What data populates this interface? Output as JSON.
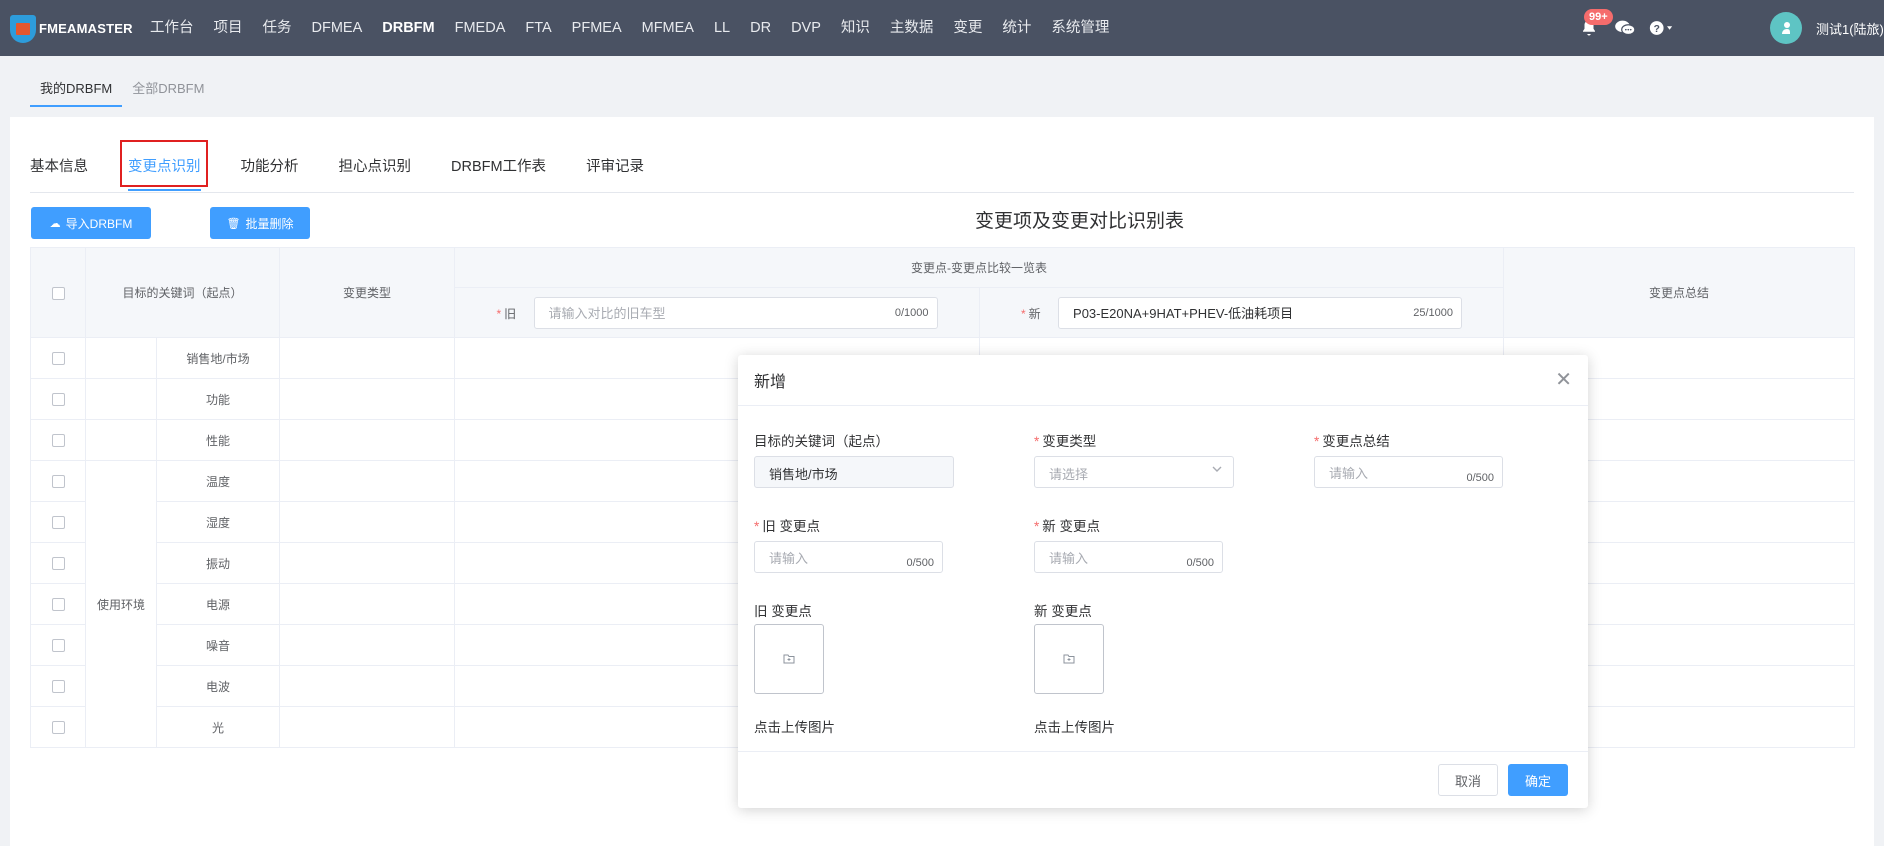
{
  "nav": {
    "logo_text": "FMEAMASTER",
    "menu": [
      "工作台",
      "项目",
      "任务",
      "DFMEA",
      "DRBFM",
      "FMEDA",
      "FTA",
      "PFMEA",
      "MFMEA",
      "LL",
      "DR",
      "DVP",
      "知识",
      "主数据",
      "变更",
      "统计",
      "系统管理"
    ],
    "active_menu": "DRBFM",
    "notification_badge": "99+",
    "username": "测试1(陆旅)",
    "icons": [
      "bell-icon",
      "chat-icon",
      "help-icon"
    ]
  },
  "subtabs": [
    "我的DRBFM",
    "全部DRBFM"
  ],
  "tabs": [
    "基本信息",
    "变更点识别",
    "功能分析",
    "担心点识别",
    "DRBFM工作表",
    "评审记录"
  ],
  "toolbar": {
    "import_label": "导入DRBFM",
    "batch_delete_label": "批量删除"
  },
  "table": {
    "title": "变更项及变更对比识别表",
    "col_keyword": "目标的关键词（起点）",
    "col_type": "变更类型",
    "col_compare": "变更点-变更点比较一览表",
    "col_summary": "变更点总结",
    "old_label": "旧",
    "new_label": "新",
    "old_placeholder": "请输入对比的旧车型",
    "old_count": "0/1000",
    "new_value": "P03-E20NA+9HAT+PHEV-低油耗项目",
    "new_count": "25/1000",
    "group_label": "使用环境",
    "rows": [
      "销售地/市场",
      "功能",
      "性能",
      "温度",
      "湿度",
      "振动",
      "电源",
      "噪音",
      "电波",
      "光"
    ]
  },
  "dialog": {
    "title": "新增",
    "keyword_label": "目标的关键词（起点）",
    "keyword_value": "销售地/市场",
    "type_label": "变更类型",
    "type_placeholder": "请选择",
    "summary_label": "变更点总结",
    "summary_placeholder": "请输入",
    "summary_count": "0/500",
    "old_point_label": "旧 变更点",
    "old_point_placeholder": "请输入",
    "old_point_count": "0/500",
    "new_point_label": "新 变更点",
    "new_point_placeholder": "请输入",
    "new_point_count": "0/500",
    "old_image_label": "旧 变更点",
    "new_image_label": "新 变更点",
    "upload_hint": "点击上传图片",
    "cancel_label": "取消",
    "ok_label": "确定"
  },
  "colors": {
    "nav_bg": "#4a5263",
    "primary": "#409eff",
    "required": "#f56c6c",
    "highlight": "#e02020"
  }
}
